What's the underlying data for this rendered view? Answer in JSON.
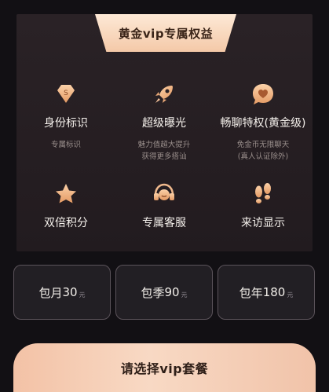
{
  "header": {
    "title": "黄金vip专属权益"
  },
  "benefits": [
    {
      "icon": "diamond-badge-icon",
      "name": "身份标识",
      "desc": "专属标识"
    },
    {
      "icon": "rocket-icon",
      "name": "超级曝光",
      "desc": "魅力值超大提升\n获得更多搭讪"
    },
    {
      "icon": "heart-chat-icon",
      "name": "畅聊特权(黄金级)",
      "desc": "免金币无限聊天\n(真人认证除外)"
    },
    {
      "icon": "star-icon",
      "name": "双倍积分",
      "desc": ""
    },
    {
      "icon": "headset-icon",
      "name": "专属客服",
      "desc": ""
    },
    {
      "icon": "footprints-icon",
      "name": "来访显示",
      "desc": ""
    }
  ],
  "plans": [
    {
      "name": "包月",
      "price": "30",
      "unit": "元"
    },
    {
      "name": "包季",
      "price": "90",
      "unit": "元"
    },
    {
      "name": "包年",
      "price": "180",
      "unit": "元"
    }
  ],
  "cta": {
    "label": "请选择vip套餐"
  },
  "colors": {
    "accent": "#f4c9a8",
    "background": "#121014",
    "card": "#2a2226",
    "icon": "#f0b98d"
  }
}
